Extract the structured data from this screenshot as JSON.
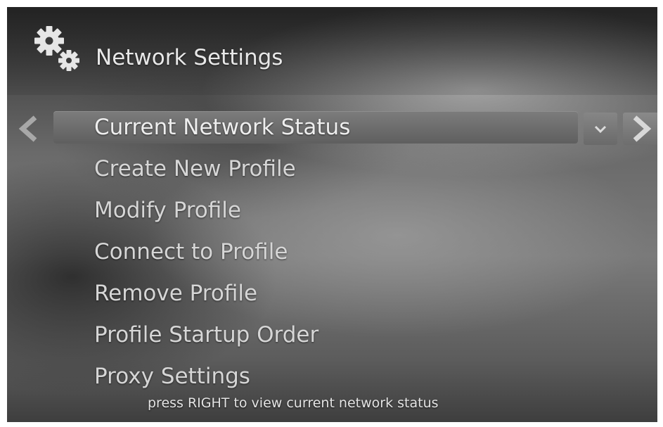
{
  "header": {
    "icon": "gears-icon",
    "title": "Network Settings"
  },
  "navigation": {
    "left_icon": "chevron-left-icon",
    "right_icon": "chevron-right-icon",
    "dropdown_icon": "chevron-down-icon"
  },
  "menu": {
    "items": [
      {
        "label": "Current Network Status",
        "selected": true
      },
      {
        "label": "Create New Profile",
        "selected": false
      },
      {
        "label": "Modify Profile",
        "selected": false
      },
      {
        "label": "Connect to Profile",
        "selected": false
      },
      {
        "label": "Remove Profile",
        "selected": false
      },
      {
        "label": "Profile Startup Order",
        "selected": false
      },
      {
        "label": "Proxy Settings",
        "selected": false
      }
    ]
  },
  "footer": {
    "hint": "press RIGHT to view current network status"
  },
  "colors": {
    "text": "#d6d6d6",
    "highlight": "#6e6e6e",
    "background": "#5a5a5a"
  }
}
